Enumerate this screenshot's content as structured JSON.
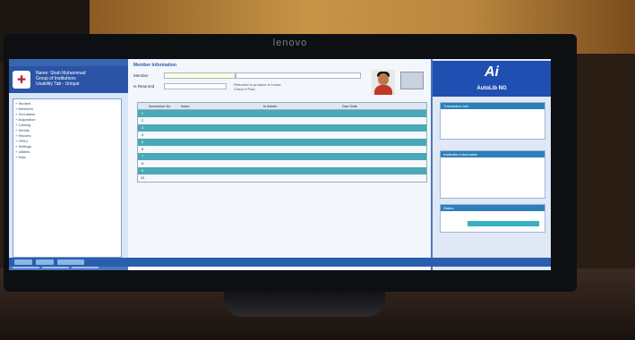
{
  "monitor": {
    "brand": "lenovo"
  },
  "sidebar": {
    "title": "",
    "info": [
      "Name: Shah Muhammad",
      "Group of Institutions",
      "Usability Tab - Unique"
    ],
    "tree": [
      "+ Student",
      "+ Members",
      "+ Circulation",
      "+ Acquisition",
      "+ Catalog",
      "+ Serials",
      "+ Reports",
      "+ OPAC",
      "+ Settings",
      "+ Utilities",
      "+ Help"
    ],
    "buttons": [
      "",
      "",
      ""
    ]
  },
  "main": {
    "title": "Member Information",
    "member_label": "Member",
    "member_value": "",
    "status_label": "Is Returned",
    "status_value": "",
    "hint": [
      "Returned to produce in Lease",
      "Check if Past"
    ],
    "go_label": "",
    "columns": [
      "",
      "Accession No",
      "Issue",
      "Is Admin",
      "Due Date"
    ],
    "rows": [
      [
        "1",
        "",
        "",
        "",
        ""
      ],
      [
        "2",
        "",
        "",
        "",
        ""
      ],
      [
        "3",
        "",
        "",
        "",
        ""
      ],
      [
        "4",
        "",
        "",
        "",
        ""
      ],
      [
        "5",
        "",
        "",
        "",
        ""
      ],
      [
        "6",
        "",
        "",
        "",
        ""
      ],
      [
        "7",
        "",
        "",
        "",
        ""
      ],
      [
        "8",
        "",
        "",
        "",
        ""
      ],
      [
        "9",
        "",
        "",
        "",
        ""
      ],
      [
        "10",
        "",
        "",
        "",
        ""
      ]
    ]
  },
  "right": {
    "logo_mark": "Ai",
    "logo_text": "AutoLib NG",
    "section1": {
      "title": "Transaction Info",
      "lines": [
        "",
        "",
        ""
      ]
    },
    "section2": {
      "title": "Institution Information",
      "lines": [
        "",
        "",
        "",
        "",
        ""
      ]
    },
    "section3": {
      "title": "Status",
      "lines": [
        "",
        ""
      ]
    }
  },
  "colors": {
    "accent": "#2b53a6",
    "row_highlight": "#49a9b6",
    "logo_bg": "#1f4fb0"
  }
}
